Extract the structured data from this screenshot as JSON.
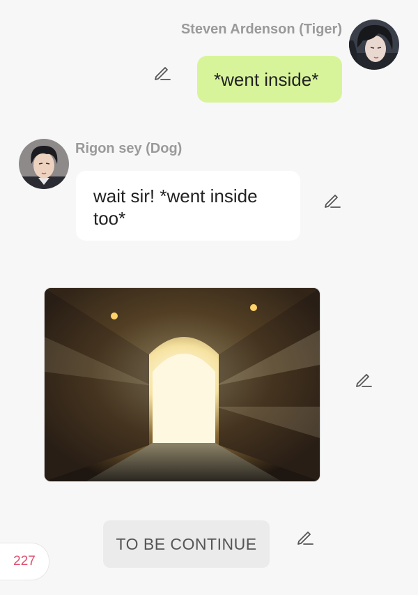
{
  "messages": [
    {
      "sender": "Steven Ardenson (Tiger)",
      "text": "*went inside*",
      "avatar": "steven-avatar",
      "bubble_color": "#d7f49a"
    },
    {
      "sender": "Rigon sey (Dog)",
      "text": "wait sir! *went inside too*",
      "avatar": "rigon-avatar",
      "bubble_color": "#ffffff"
    }
  ],
  "image_message": {
    "description_icon": "tunnel-image"
  },
  "narration": {
    "text": "TO BE CONTINUE"
  },
  "counter": {
    "value": "227",
    "color": "#e0506e"
  },
  "icons": {
    "edit": "pencil-icon"
  },
  "colors": {
    "background": "#f7f7f7",
    "sender_name": "#9a9a9a",
    "outgoing_bubble": "#d7f49a",
    "incoming_bubble": "#ffffff"
  }
}
